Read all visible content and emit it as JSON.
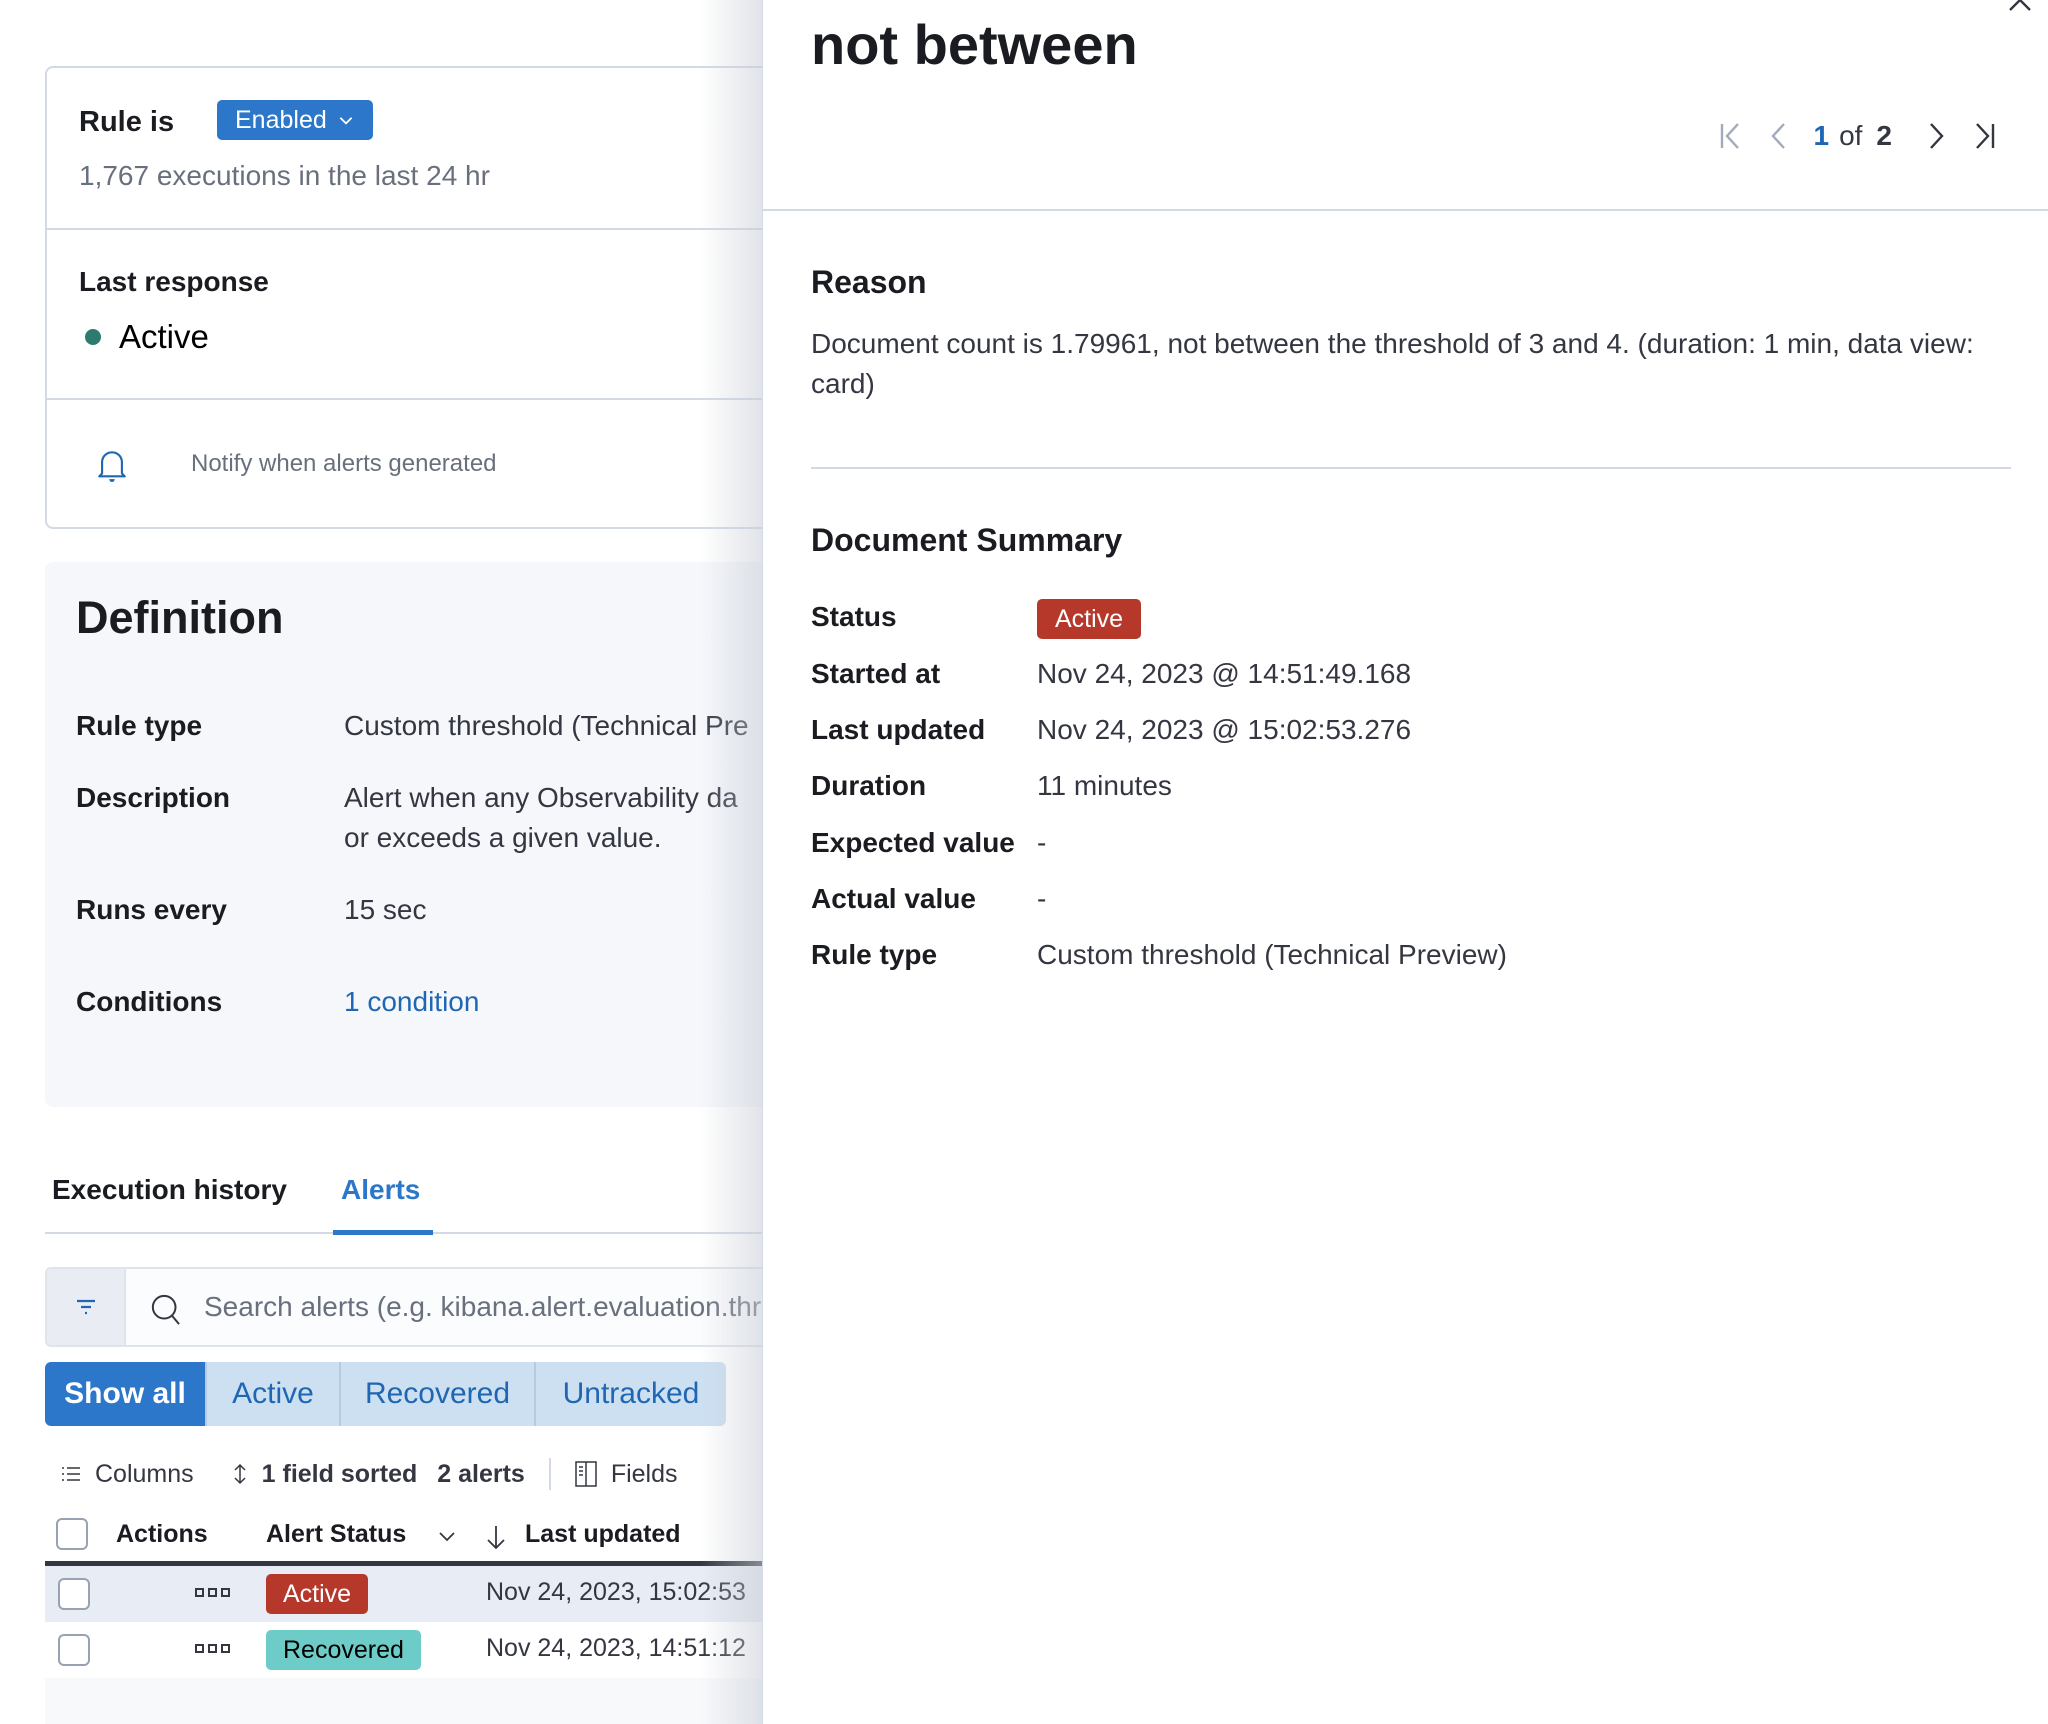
{
  "rule_card": {
    "rule_is_label": "Rule is",
    "enabled_button": "Enabled",
    "executions_text": "1,767 executions in the last 24 hr",
    "last_response_label": "Last response",
    "last_response_value": "Active",
    "notify_text": "Notify when alerts generated",
    "active_dot_color": "#2d7a6e"
  },
  "definition": {
    "title": "Definition",
    "rows": [
      {
        "label": "Rule type",
        "value": "Custom threshold (Technical Pre"
      },
      {
        "label": "Description",
        "value": "Alert when any Observability da",
        "value2": "or exceeds a given value."
      },
      {
        "label": "Runs every",
        "value": "15 sec"
      },
      {
        "label": "Conditions",
        "value": "1 condition"
      }
    ]
  },
  "tabs": [
    {
      "label": "Execution history",
      "active": false
    },
    {
      "label": "Alerts",
      "active": true
    }
  ],
  "search": {
    "placeholder": "Search alerts (e.g. kibana.alert.evaluation.thr"
  },
  "status_filter": {
    "options": [
      "Show all",
      "Active",
      "Recovered",
      "Untracked"
    ],
    "selected": "Show all"
  },
  "toolbar": {
    "columns": "Columns",
    "sorted": "1 field sorted",
    "count": "2 alerts",
    "fields": "Fields"
  },
  "table": {
    "headers": {
      "actions": "Actions",
      "status": "Alert Status",
      "last_updated": "Last updated"
    },
    "rows": [
      {
        "status": "Active",
        "last_updated": "Nov 24, 2023, 15:02:53"
      },
      {
        "status": "Recovered",
        "last_updated": "Nov 24, 2023, 14:51:12"
      }
    ]
  },
  "flyout": {
    "title": "not between",
    "pagination": {
      "current": "1",
      "of": "of",
      "total": "2"
    },
    "reason_title": "Reason",
    "reason_text": "Document count is 1.79961, not between the threshold of 3 and 4. (duration: 1 min, data view: card)",
    "summary_title": "Document Summary",
    "summary": {
      "status_label": "Status",
      "status_value": "Active",
      "started_label": "Started at",
      "started_value": "Nov 24, 2023 @ 14:51:49.168",
      "updated_label": "Last updated",
      "updated_value": "Nov 24, 2023 @ 15:02:53.276",
      "duration_label": "Duration",
      "duration_value": "11 minutes",
      "expected_label": "Expected value",
      "expected_value": "-",
      "actual_label": "Actual value",
      "actual_value": "-",
      "ruletype_label": "Rule type",
      "ruletype_value": "Custom threshold (Technical Preview)"
    }
  },
  "colors": {
    "primary": "#2c77c9",
    "link": "#1f66b3",
    "danger_badge": "#b5382a",
    "recovered_badge": "#6dccc7"
  }
}
